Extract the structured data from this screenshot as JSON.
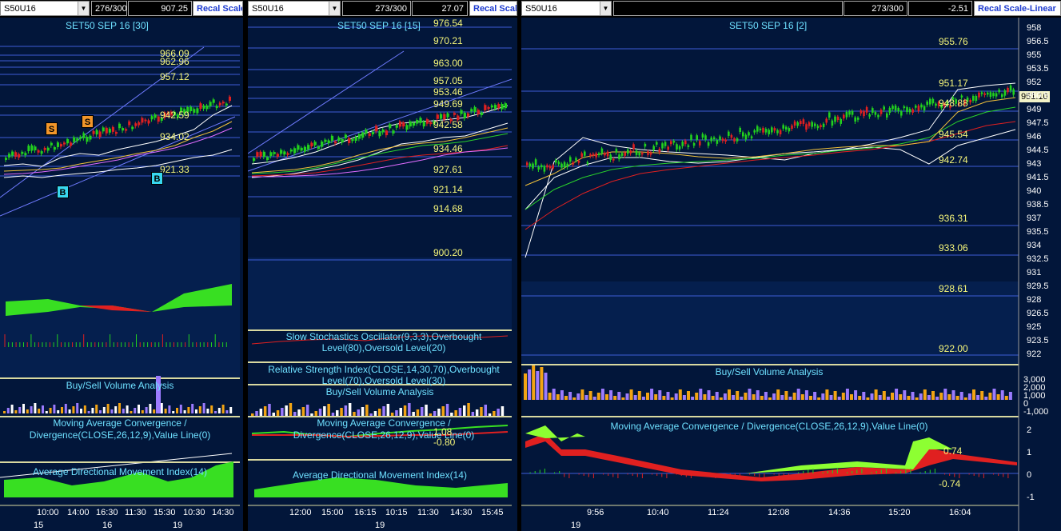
{
  "panes": [
    {
      "symbol": "S50U16",
      "count": "276/300",
      "change": "907.25",
      "recal_label": "Recal Scale",
      "chart_title": "SET50 SEP 16  [30]",
      "price_labels": [
        "966.09",
        "962.96",
        "957.12",
        "942.59",
        "934.02",
        "921.33"
      ],
      "markers": {
        "sell": "S",
        "buy": "B"
      },
      "indicators": {
        "volume": "Buy/Sell Volume Analysis",
        "macd": "Moving Average Convergence / Divergence(CLOSE,26,12,9),Value Line(0)",
        "adx": "Average Directional Movement Index(14)"
      },
      "time_labels": [
        "10:00",
        "14:00",
        "16:30",
        "11:30",
        "15:30",
        "10:30",
        "14:30"
      ],
      "date_labels": [
        "15",
        "16",
        "19"
      ]
    },
    {
      "symbol": "S50U16",
      "count": "273/300",
      "change": "27.07",
      "recal_label": "Recal Scale",
      "chart_title": "SET50 SEP 16  [15]",
      "price_labels": [
        "976.54",
        "970.21",
        "963.00",
        "957.05",
        "953.46",
        "949.69",
        "942.58",
        "934.46",
        "927.61",
        "921.14",
        "914.68",
        "900.20"
      ],
      "indicators": {
        "stoch": "Slow Stochastics Oscillator(9,3,3),Overbought Level(80),Oversold Level(20)",
        "rsi": "Relative Strength Index(CLOSE,14,30,70),Overbought Level(70),Oversold Level(30)",
        "volume": "Buy/Sell Volume Analysis",
        "macd": "Moving Average Convergence / Divergence(CLOSE,26,12,9),Value Line(0)",
        "macd_hi": "1.08",
        "macd_lo": "-0.80",
        "adx": "Average Directional Movement Index(14)"
      },
      "time_labels": [
        "12:00",
        "15:00",
        "16:15",
        "10:15",
        "11:30",
        "14:30",
        "15:45"
      ],
      "date_labels": [
        "19"
      ]
    },
    {
      "symbol": "S50U16",
      "count": "273/300",
      "change": "-2.51",
      "recal_label": "Recal Scale-Linear",
      "chart_title": "SET50 SEP 16  [2]",
      "price_labels": [
        "955.76",
        "951.17",
        "948.88",
        "945.54",
        "942.74",
        "936.31",
        "933.06",
        "928.61",
        "922.00"
      ],
      "last_price": "951.10",
      "y_axis": [
        "958",
        "956.5",
        "955",
        "953.5",
        "952",
        "950.5",
        "949",
        "947.5",
        "946",
        "944.5",
        "943",
        "941.5",
        "940",
        "938.5",
        "937",
        "935.5",
        "934",
        "932.5",
        "931",
        "929.5",
        "928",
        "926.5",
        "925",
        "923.5",
        "922"
      ],
      "volume_axis": [
        "3,000",
        "2,000",
        "1,000",
        "0",
        "-1,000"
      ],
      "macd_axis": [
        "2",
        "1",
        "0",
        "-1"
      ],
      "indicators": {
        "volume": "Buy/Sell Volume Analysis",
        "macd": "Moving Average Convergence / Divergence(CLOSE,26,12,9),Value Line(0)",
        "macd_hi": "0.74",
        "macd_lo": "-0.74"
      },
      "time_labels": [
        "9:56",
        "10:40",
        "11:24",
        "12:08",
        "14:36",
        "15:20",
        "16:04"
      ],
      "date_labels": [
        "19"
      ]
    }
  ],
  "colors": {
    "background": "#02163a",
    "price_label": "#f7f77a",
    "title": "#6ee0ff",
    "up": "#22d11e",
    "down": "#e02020",
    "macd_fill": "#4ef32a"
  }
}
